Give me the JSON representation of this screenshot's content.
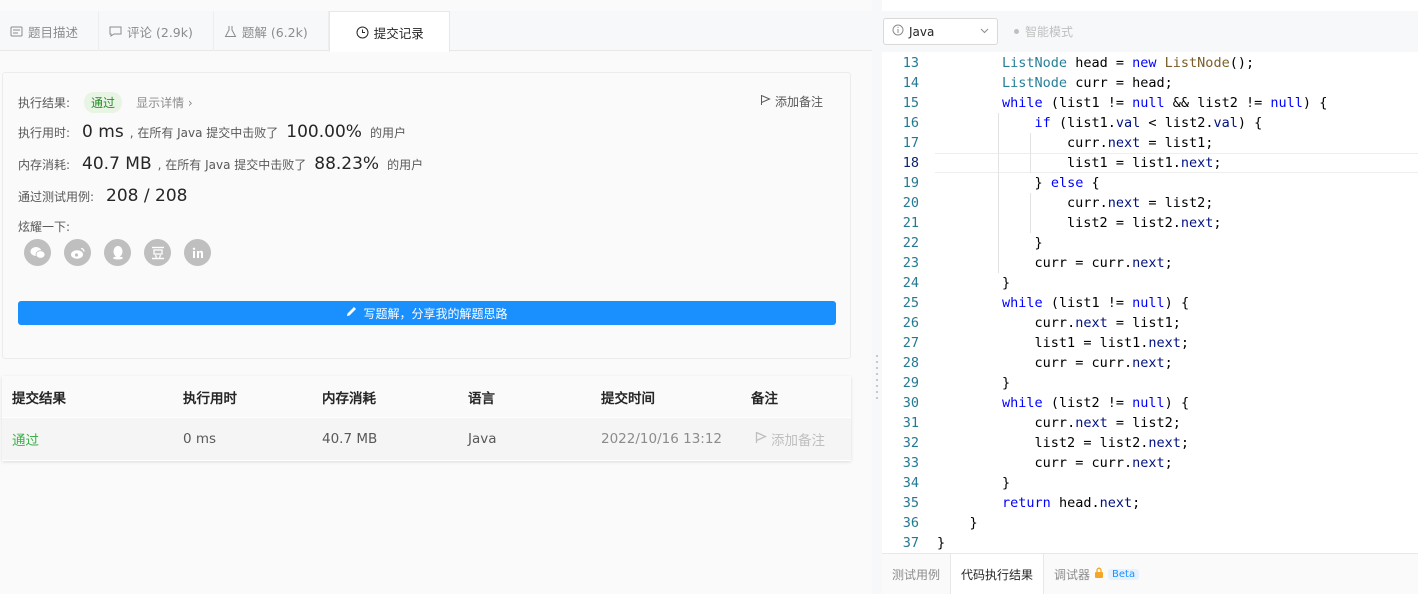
{
  "tabs": [
    {
      "label": "题目描述",
      "icon": "document-icon"
    },
    {
      "label": "评论 (2.9k)",
      "icon": "comment-icon"
    },
    {
      "label": "题解 (6.2k)",
      "icon": "flask-icon"
    },
    {
      "label": "提交记录",
      "icon": "clock-icon"
    }
  ],
  "result": {
    "status_label": "执行结果:",
    "status": "通过",
    "details_link": "显示详情",
    "add_note": "添加备注",
    "runtime_label": "执行用时:",
    "runtime": "0 ms",
    "runtime_text": ", 在所有 Java 提交中击败了",
    "runtime_pct": "100.00%",
    "runtime_suffix": "的用户",
    "memory_label": "内存消耗:",
    "memory": "40.7 MB",
    "memory_text": ", 在所有 Java 提交中击败了",
    "memory_pct": "88.23%",
    "memory_suffix": "的用户",
    "tests_label": "通过测试用例:",
    "tests": "208 / 208",
    "share_label": "炫耀一下:",
    "share_icons": [
      "wechat-icon",
      "weibo-icon",
      "qq-icon",
      "douban-icon",
      "linkedin-icon"
    ],
    "write_button": "写题解，分享我的解题思路"
  },
  "table": {
    "headers": [
      "提交结果",
      "执行用时",
      "内存消耗",
      "语言",
      "提交时间",
      "备注"
    ],
    "row": {
      "result": "通过",
      "runtime": "0 ms",
      "memory": "40.7 MB",
      "language": "Java",
      "time": "2022/10/16 13:12",
      "note": "添加备注"
    }
  },
  "editor": {
    "language": "Java",
    "smart_mode": "智能模式",
    "current_line": 18,
    "lines": [
      {
        "n": "13"
      },
      {
        "n": "14"
      },
      {
        "n": "15"
      },
      {
        "n": "16"
      },
      {
        "n": "17"
      },
      {
        "n": "18"
      },
      {
        "n": "19"
      },
      {
        "n": "20"
      },
      {
        "n": "21"
      },
      {
        "n": "22"
      },
      {
        "n": "23"
      },
      {
        "n": "24"
      },
      {
        "n": "25"
      },
      {
        "n": "26"
      },
      {
        "n": "27"
      },
      {
        "n": "28"
      },
      {
        "n": "29"
      },
      {
        "n": "30"
      },
      {
        "n": "31"
      },
      {
        "n": "32"
      },
      {
        "n": "33"
      },
      {
        "n": "34"
      },
      {
        "n": "35"
      },
      {
        "n": "36"
      },
      {
        "n": "37"
      }
    ],
    "code": [
      "        ListNode head = new ListNode();",
      "        ListNode curr = head;",
      "        while (list1 != null && list2 != null) {",
      "            if (list1.val < list2.val) {",
      "                curr.next = list1;",
      "                list1 = list1.next;",
      "            } else {",
      "                curr.next = list2;",
      "                list2 = list2.next;",
      "            }",
      "            curr = curr.next;",
      "        }",
      "        while (list1 != null) {",
      "            curr.next = list1;",
      "            list1 = list1.next;",
      "            curr = curr.next;",
      "        }",
      "        while (list2 != null) {",
      "            curr.next = list2;",
      "            list2 = list2.next;",
      "            curr = curr.next;",
      "        }",
      "        return head.next;",
      "    }",
      "}"
    ]
  },
  "bottom_tabs": [
    {
      "label": "测试用例"
    },
    {
      "label": "代码执行结果"
    },
    {
      "label": "调试器",
      "badge": "Beta"
    }
  ]
}
